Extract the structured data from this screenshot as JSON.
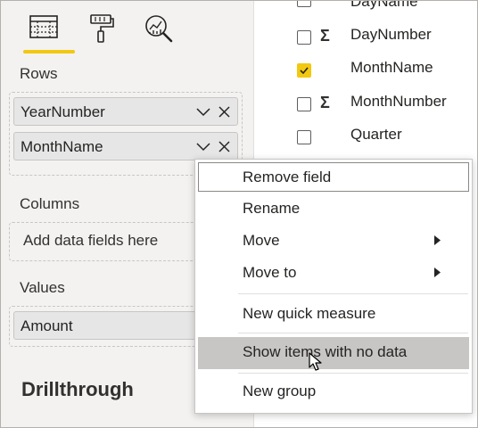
{
  "visualizations_pane": {
    "tabs": [
      {
        "name": "fields",
        "icon": "fields-icon",
        "active": true
      },
      {
        "name": "format",
        "icon": "paint-roller-icon",
        "active": false
      },
      {
        "name": "analytics",
        "icon": "analytics-magnifier-icon",
        "active": false
      }
    ],
    "accent_color": "#f2c811",
    "rows_label": "Rows",
    "rows_fields": [
      "YearNumber",
      "MonthName"
    ],
    "columns_label": "Columns",
    "columns_placeholder": "Add data fields here",
    "values_label": "Values",
    "values_fields": [
      "Amount"
    ],
    "drillthrough_title": "Drillthrough"
  },
  "field_list": {
    "items": [
      {
        "name": "DayName",
        "checked": false,
        "sigma": false
      },
      {
        "name": "DayNumber",
        "checked": false,
        "sigma": true,
        "sigma_symbol": "Σ"
      },
      {
        "name": "MonthName",
        "checked": true,
        "sigma": false
      },
      {
        "name": "MonthNumber",
        "checked": false,
        "sigma": true,
        "sigma_symbol": "Σ"
      },
      {
        "name": "Quarter",
        "checked": false,
        "sigma": false
      }
    ]
  },
  "context_menu": {
    "items": [
      {
        "label": "Remove field",
        "state": "focused"
      },
      {
        "label": "Rename"
      },
      {
        "label": "Move",
        "submenu": true
      },
      {
        "label": "Move to",
        "submenu": true
      },
      {
        "label": "New quick measure"
      },
      {
        "label": "Show items with no data",
        "state": "hovered"
      },
      {
        "label": "New group"
      }
    ]
  }
}
